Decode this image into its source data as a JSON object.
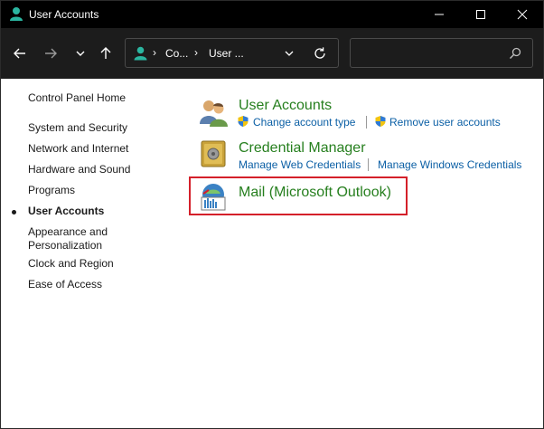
{
  "window": {
    "title": "User Accounts"
  },
  "address_bar": {
    "crumbs": [
      "Co...",
      "User ..."
    ]
  },
  "search": {
    "placeholder": ""
  },
  "sidebar": {
    "items": [
      {
        "label": "Control Panel Home",
        "active": false
      },
      {
        "label": "System and Security",
        "active": false
      },
      {
        "label": "Network and Internet",
        "active": false
      },
      {
        "label": "Hardware and Sound",
        "active": false
      },
      {
        "label": "Programs",
        "active": false
      },
      {
        "label": "User Accounts",
        "active": true
      },
      {
        "label": "Appearance and",
        "active": false
      },
      {
        "label": "Personalization",
        "active": false
      },
      {
        "label": "Clock and Region",
        "active": false
      },
      {
        "label": "Ease of Access",
        "active": false
      }
    ]
  },
  "main": {
    "categories": [
      {
        "title": "User Accounts",
        "icon": "users-icon",
        "links": [
          "Change account type",
          "Remove user accounts"
        ]
      },
      {
        "title": "Credential Manager",
        "icon": "vault-icon",
        "links": [
          "Manage Web Credentials",
          "Manage Windows Credentials"
        ]
      },
      {
        "title": "Mail (Microsoft Outlook)",
        "icon": "mail-icon",
        "links": []
      }
    ]
  },
  "colors": {
    "category_title": "#267f1e",
    "link": "#0b5fa5",
    "highlight": "#d4202a",
    "titlebar": "#000000",
    "toolbar": "#1c1c1c"
  }
}
